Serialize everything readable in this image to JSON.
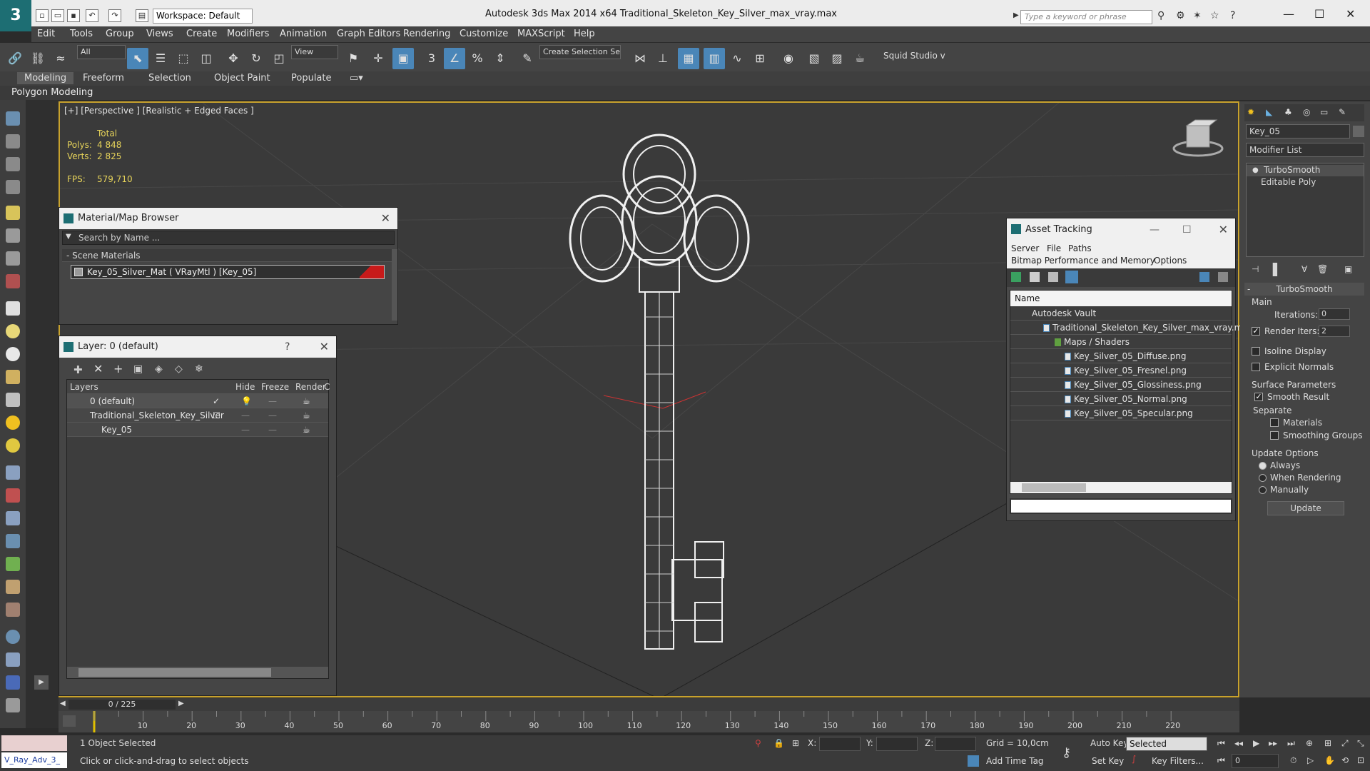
{
  "titlebar": {
    "workspace": "Workspace: Default",
    "title": "Autodesk 3ds Max  2014 x64       Traditional_Skeleton_Key_Silver_max_vray.max",
    "search_placeholder": "Type a keyword or phrase"
  },
  "menu": [
    "Edit",
    "Tools",
    "Group",
    "Views",
    "Create",
    "Modifiers",
    "Animation",
    "Graph Editors",
    "Rendering",
    "Customize",
    "MAXScript",
    "Help"
  ],
  "toolbar": {
    "selection_filter": "All",
    "ref_coord": "View",
    "named_selection": "Create Selection Se",
    "squid": "Squid Studio v"
  },
  "ribbon": {
    "tabs": [
      "Modeling",
      "Freeform",
      "Selection",
      "Object Paint",
      "Populate"
    ],
    "sub": "Polygon Modeling"
  },
  "viewport": {
    "label": "[+] [Perspective ] [Realistic + Edged Faces ]",
    "stats_total": "Total",
    "polys_label": "Polys:",
    "polys_value": "4 848",
    "verts_label": "Verts:",
    "verts_value": "2 825",
    "fps_label": "FPS:",
    "fps_value": "579,710"
  },
  "material_browser": {
    "title": "Material/Map Browser",
    "search_placeholder": "Search by Name ...",
    "section": "- Scene Materials",
    "item": "Key_05_Silver_Mat  ( VRayMtl )  [Key_05]"
  },
  "layer_panel": {
    "title": "Layer: 0 (default)",
    "help": "?",
    "columns": [
      "Layers",
      "Hide",
      "Freeze",
      "Render",
      "C"
    ],
    "rows": [
      {
        "name": "0 (default)"
      },
      {
        "name": "Traditional_Skeleton_Key_Silver"
      },
      {
        "name": "Key_05"
      }
    ]
  },
  "asset_tracking": {
    "title": "Asset Tracking",
    "menu": [
      "Server",
      "File",
      "Paths"
    ],
    "menu2": [
      "Bitmap Performance and Memory",
      "Options"
    ],
    "column": "Name",
    "rows": [
      "Autodesk Vault",
      "Traditional_Skeleton_Key_Silver_max_vray.max",
      "Maps / Shaders",
      "Key_Silver_05_Diffuse.png",
      "Key_Silver_05_Fresnel.png",
      "Key_Silver_05_Glossiness.png",
      "Key_Silver_05_Normal.png",
      "Key_Silver_05_Specular.png"
    ]
  },
  "command_panel": {
    "object_name": "Key_05",
    "modifier_list": "Modifier List",
    "stack": [
      "TurboSmooth",
      "Editable Poly"
    ],
    "rollout": "TurboSmooth",
    "main": "Main",
    "iterations_label": "Iterations:",
    "iterations_value": "0",
    "render_iters_label": "Render Iters:",
    "render_iters_value": "2",
    "isoline": "Isoline Display",
    "explicit": "Explicit Normals",
    "surface": "Surface Parameters",
    "smooth_result": "Smooth Result",
    "separate": "Separate",
    "materials": "Materials",
    "smoothing_groups": "Smoothing Groups",
    "update_options": "Update Options",
    "always": "Always",
    "when_rendering": "When Rendering",
    "manually": "Manually",
    "update_btn": "Update"
  },
  "timeline": {
    "frame": "0 / 225",
    "ticks": [
      "10",
      "20",
      "30",
      "40",
      "50",
      "60",
      "70",
      "80",
      "90",
      "100",
      "110",
      "120",
      "130",
      "140",
      "150",
      "160",
      "170",
      "180",
      "190",
      "200",
      "210",
      "220"
    ]
  },
  "status": {
    "script": "V_Ray_Adv_3_",
    "selected": "1 Object Selected",
    "prompt": "Click or click-and-drag to select objects",
    "x_label": "X:",
    "y_label": "Y:",
    "z_label": "Z:",
    "grid": "Grid = 10,0cm",
    "add_time_tag": "Add Time Tag",
    "auto_key": "Auto Key",
    "set_key": "Set Key",
    "selected_dd": "Selected",
    "key_filters": "Key Filters...",
    "frame_field": "0"
  }
}
